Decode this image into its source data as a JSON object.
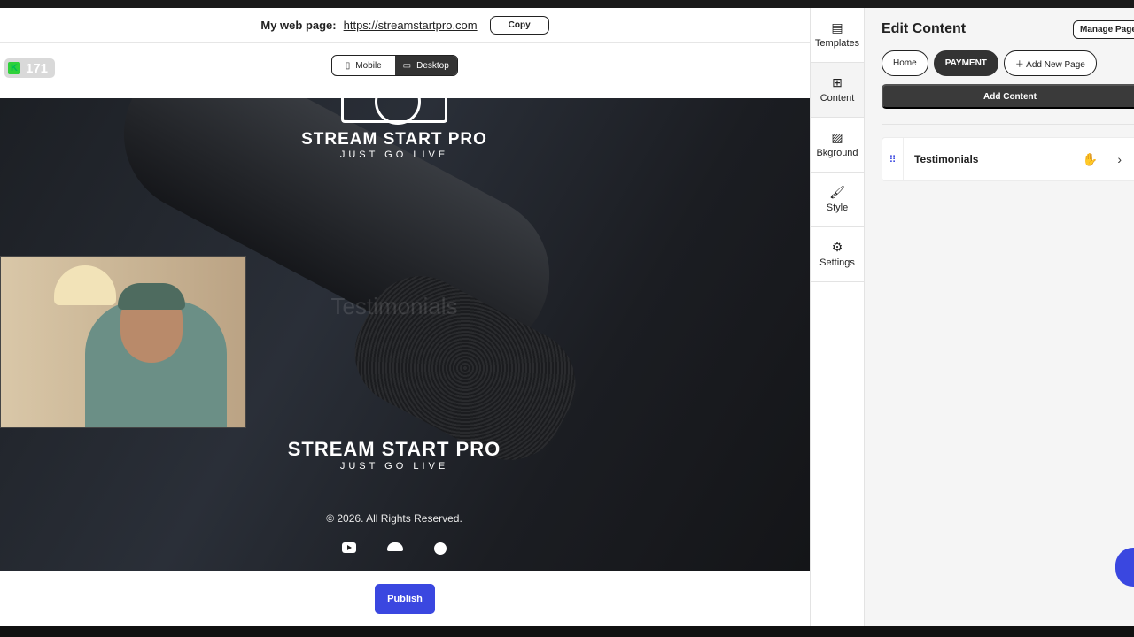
{
  "url_bar": {
    "label": "My web page:",
    "url": "https://streamstartpro.com",
    "copy_label": "Copy"
  },
  "badge": {
    "count": "171"
  },
  "device_toggle": {
    "mobile_label": "Mobile",
    "desktop_label": "Desktop",
    "active": "Desktop"
  },
  "preview": {
    "brand_title": "STREAM START PRO",
    "brand_subtitle": "JUST GO LIVE",
    "faded_heading": "Testimonials",
    "footer_brand_title": "STREAM START PRO",
    "footer_brand_subtitle": "JUST GO LIVE",
    "copyright": "© 2026. All Rights Reserved.",
    "socials": [
      "youtube-icon",
      "soundcloud-icon",
      "spotify-icon"
    ]
  },
  "publish": {
    "label": "Publish",
    "color": "#3a47e0"
  },
  "rail": {
    "items": [
      {
        "label": "Templates",
        "icon": "templates-icon"
      },
      {
        "label": "Content",
        "icon": "content-icon"
      },
      {
        "label": "Bkground",
        "icon": "background-icon"
      },
      {
        "label": "Style",
        "icon": "style-icon"
      },
      {
        "label": "Settings",
        "icon": "settings-icon"
      }
    ]
  },
  "panel": {
    "title": "Edit Content",
    "manage_pages_label": "Manage Pages",
    "pages": [
      "Home",
      "PAYMENT",
      "Add New Page"
    ],
    "active_page": "PAYMENT",
    "add_content_label": "Add Content",
    "sections": [
      {
        "label": "Testimonials"
      }
    ]
  }
}
